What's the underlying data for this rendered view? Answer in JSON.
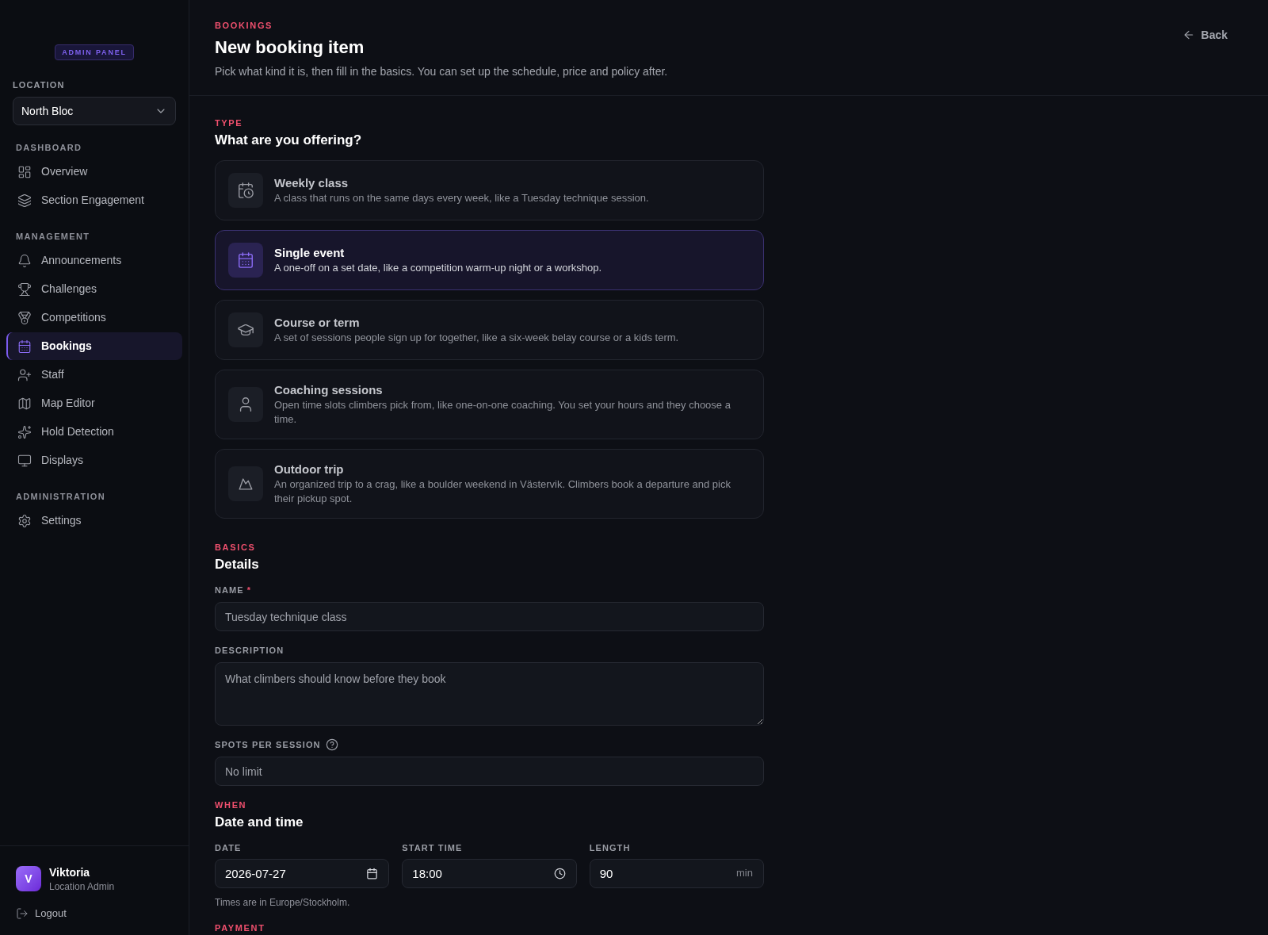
{
  "sidebar": {
    "badge": "ADMIN PANEL",
    "location": {
      "label": "LOCATION",
      "value": "North Bloc"
    },
    "sections": [
      {
        "title": "DASHBOARD",
        "items": [
          {
            "label": "Overview",
            "selected": false
          },
          {
            "label": "Section Engagement",
            "selected": false
          }
        ]
      },
      {
        "title": "MANAGEMENT",
        "items": [
          {
            "label": "Announcements",
            "selected": false
          },
          {
            "label": "Challenges",
            "selected": false
          },
          {
            "label": "Competitions",
            "selected": false
          },
          {
            "label": "Bookings",
            "selected": true
          },
          {
            "label": "Staff",
            "selected": false
          },
          {
            "label": "Map Editor",
            "selected": false
          },
          {
            "label": "Hold Detection",
            "selected": false
          },
          {
            "label": "Displays",
            "selected": false
          }
        ]
      },
      {
        "title": "ADMINISTRATION",
        "items": [
          {
            "label": "Settings",
            "selected": false
          }
        ]
      }
    ],
    "user": {
      "initial": "V",
      "name": "Viktoria",
      "role": "Location Admin"
    },
    "logout": "Logout"
  },
  "header": {
    "eyebrow": "BOOKINGS",
    "title": "New booking item",
    "subtitle": "Pick what kind it is, then fill in the basics. You can set up the schedule, price and policy after.",
    "back": "Back"
  },
  "type_section": {
    "eyebrow": "TYPE",
    "title": "What are you offering?",
    "options": [
      {
        "title": "Weekly class",
        "description": "A class that runs on the same days every week, like a Tuesday technique session.",
        "selected": false
      },
      {
        "title": "Single event",
        "description": "A one-off on a set date, like a competition warm-up night or a workshop.",
        "selected": true
      },
      {
        "title": "Course or term",
        "description": "A set of sessions people sign up for together, like a six-week belay course or a kids term.",
        "selected": false
      },
      {
        "title": "Coaching sessions",
        "description": "Open time slots climbers pick from, like one-on-one coaching. You set your hours and they choose a time.",
        "selected": false
      },
      {
        "title": "Outdoor trip",
        "description": "An organized trip to a crag, like a boulder weekend in Västervik. Climbers book a departure and pick their pickup spot.",
        "selected": false
      }
    ]
  },
  "basics": {
    "eyebrow": "BASICS",
    "title": "Details",
    "name": {
      "label": "NAME",
      "required_mark": "*",
      "placeholder": "Tuesday technique class"
    },
    "description": {
      "label": "DESCRIPTION",
      "placeholder": "What climbers should know before they book"
    },
    "spots": {
      "label": "SPOTS PER SESSION",
      "placeholder": "No limit"
    }
  },
  "when": {
    "eyebrow": "WHEN",
    "title": "Date and time",
    "fields": [
      {
        "kind": "date",
        "label": "DATE",
        "value": "2026-07-27"
      },
      {
        "kind": "time",
        "label": "START TIME",
        "value": "18:00"
      },
      {
        "kind": "duration",
        "label": "LENGTH",
        "value": "90",
        "unit": "min"
      }
    ],
    "note": "Times are in Europe/Stockholm."
  },
  "payment": {
    "eyebrow": "PAYMENT"
  }
}
